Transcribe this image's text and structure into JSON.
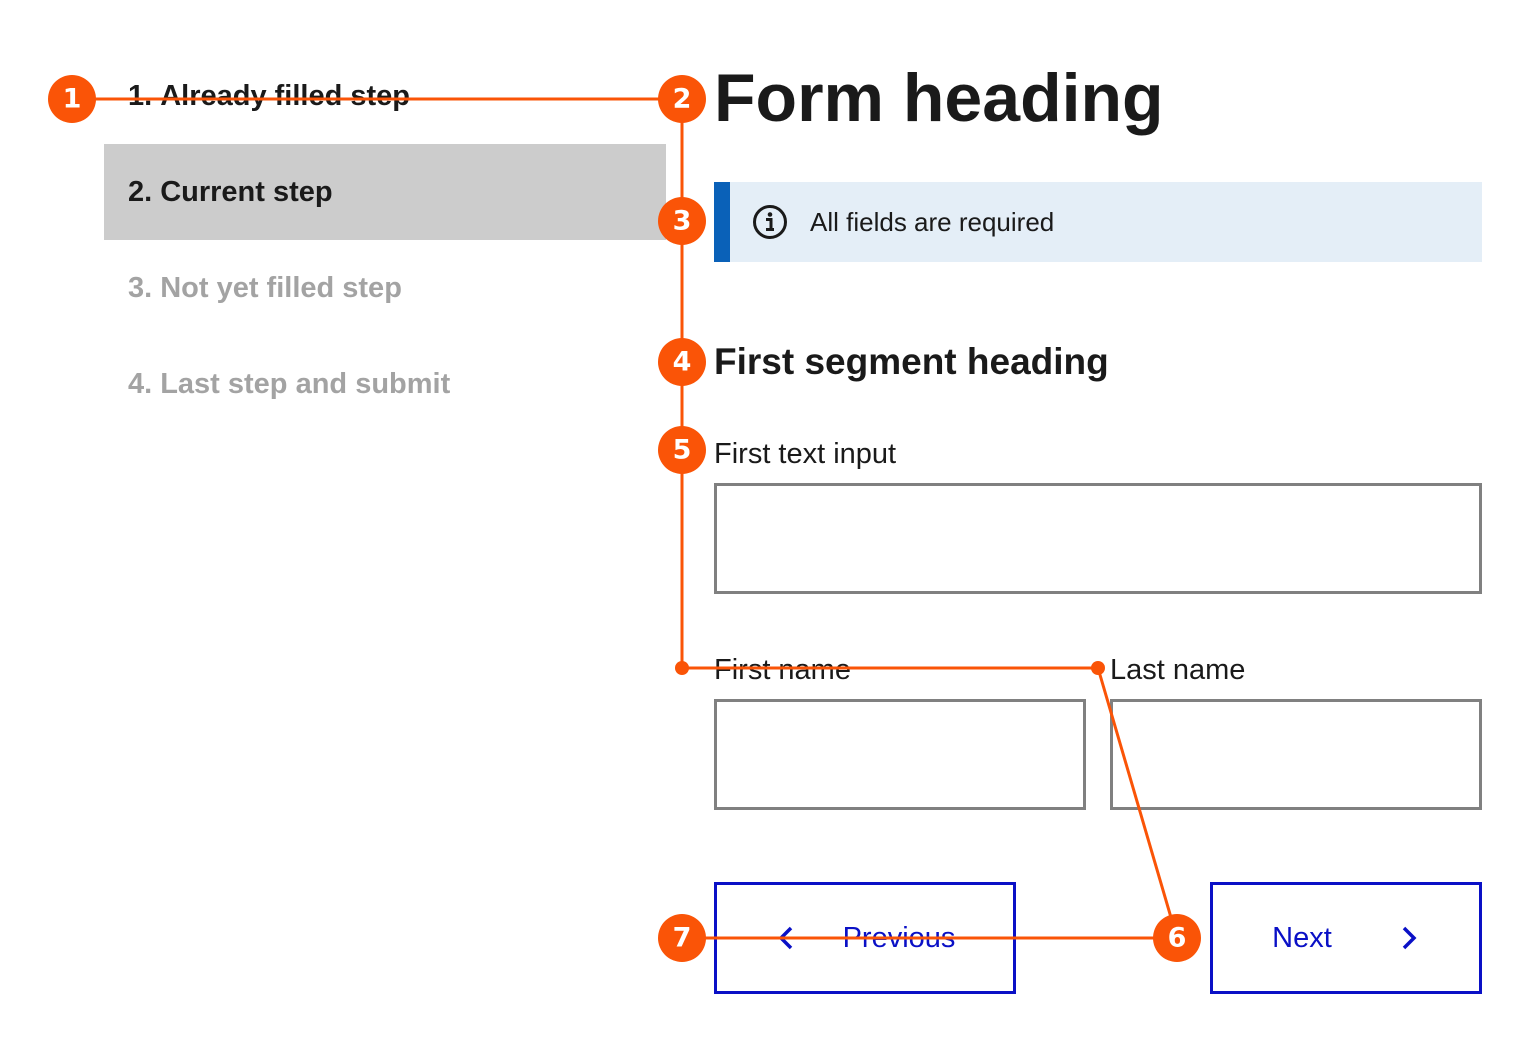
{
  "stepper": {
    "steps": [
      {
        "number": "1",
        "separator": ".",
        "label": "Already filled step",
        "state": "done"
      },
      {
        "number": "2",
        "separator": ".",
        "label": "Current step",
        "state": "current"
      },
      {
        "number": "3",
        "separator": ".",
        "label": "Not yet filled step",
        "state": "todo"
      },
      {
        "number": "4",
        "separator": ".",
        "label": "Last step and submit",
        "state": "todo"
      }
    ]
  },
  "form": {
    "heading": "Form heading",
    "notice": {
      "icon": "info-icon",
      "text": "All fields are required"
    },
    "segment_heading": "First segment heading",
    "first_text_input": {
      "label": "First text input",
      "value": ""
    },
    "first_name": {
      "label": "First name",
      "value": ""
    },
    "last_name": {
      "label": "Last name",
      "value": ""
    },
    "buttons": {
      "previous": {
        "label": "Previous",
        "icon": "chevron-left-icon"
      },
      "next": {
        "label": "Next",
        "icon": "chevron-right-icon"
      }
    }
  },
  "annotations": {
    "markers": [
      "1",
      "2",
      "3",
      "4",
      "5",
      "6",
      "7"
    ]
  },
  "colors": {
    "annotation": "#fa5407",
    "button_accent": "#0a10c6",
    "notice_background": "#e4eef7",
    "notice_accent": "#0a61b8",
    "current_step_background": "#cccccc",
    "inactive_step_text": "#a3a3a3",
    "input_border": "#808080"
  }
}
